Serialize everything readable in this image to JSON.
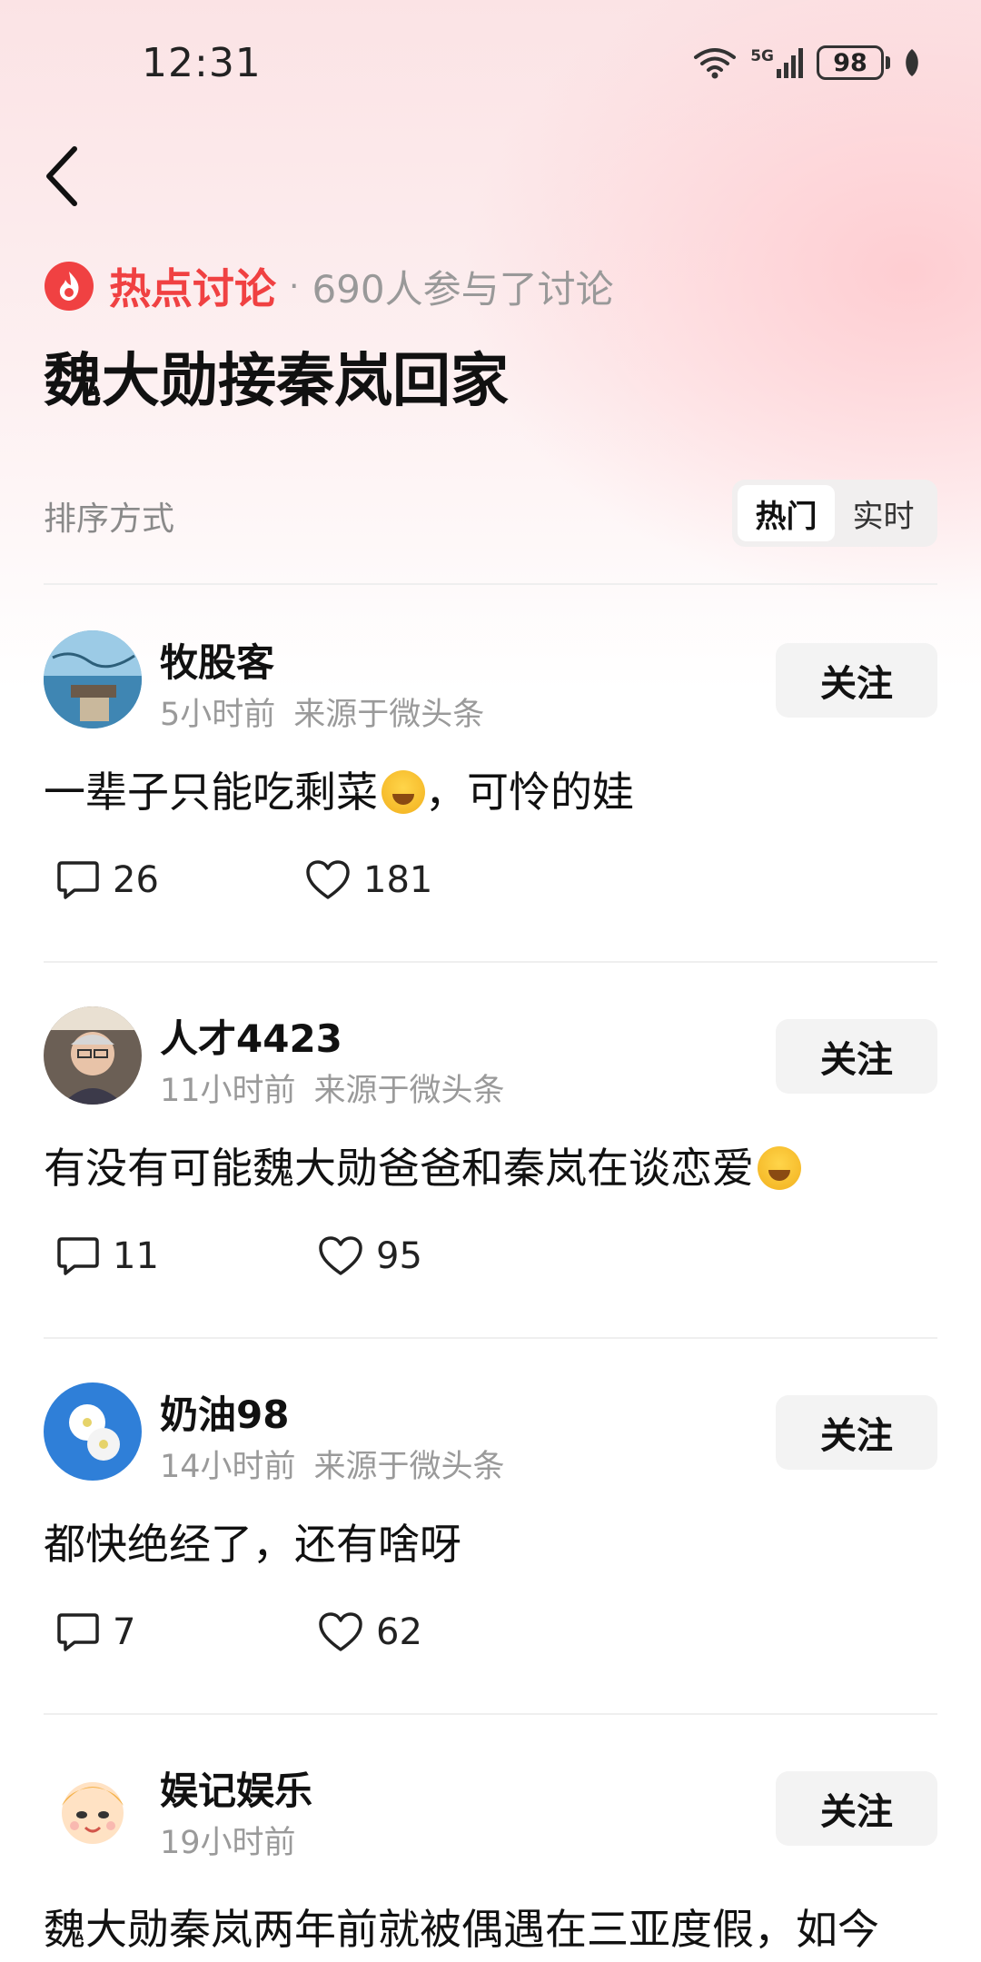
{
  "status_bar": {
    "time": "12:31",
    "network": "5G",
    "battery": "98"
  },
  "header": {
    "topic_label": "热点讨论",
    "separator": "·",
    "participants": "690人参与了讨论",
    "title": "魏大勋接秦岚回家"
  },
  "sort": {
    "label": "排序方式",
    "options": [
      "热门",
      "实时"
    ],
    "selected": "热门"
  },
  "comments": [
    {
      "user": "牧股客",
      "time": "5小时前",
      "source": "来源于微头条",
      "follow": "关注",
      "text": "一辈子只能吃剩菜",
      "text_after": "，可怜的娃",
      "comments": "26",
      "likes": "181"
    },
    {
      "user": "人才4423",
      "time": "11小时前",
      "source": "来源于微头条",
      "follow": "关注",
      "text": "有没有可能魏大勋爸爸和秦岚在谈恋爱",
      "comments": "11",
      "likes": "95"
    },
    {
      "user": "奶油98",
      "time": "14小时前",
      "source": "来源于微头条",
      "follow": "关注",
      "text": "都快绝经了，还有啥呀",
      "comments": "7",
      "likes": "62"
    },
    {
      "user": "娱记娱乐",
      "time": "19小时前",
      "follow": "关注",
      "text": "魏大勋秦岚两年前就被偶遇在三亚度假，如今"
    }
  ],
  "colors": {
    "accent": "#f04142",
    "follow_bg": "#f3f3f3",
    "meta": "#9a9a9a"
  }
}
